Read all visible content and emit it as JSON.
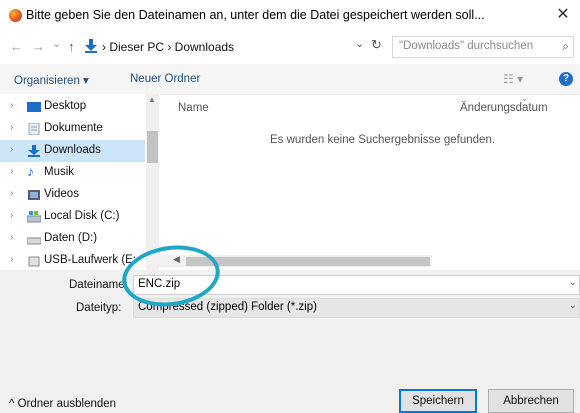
{
  "window": {
    "title": "Bitte geben Sie den Dateinamen an, unter dem die Datei gespeichert werden soll...",
    "close_glyph": "✕"
  },
  "nav": {
    "back_glyph": "←",
    "forward_glyph": "→",
    "recent_glyph": "⌄",
    "up_glyph": "↑",
    "path": "›  Dieser PC  ›  Downloads",
    "dropdown_glyph": "⌄",
    "refresh_glyph": "↻",
    "search_placeholder": "\"Downloads\" durchsuchen",
    "search_glyph": "⌕"
  },
  "toolbar": {
    "organize": "Organisieren ▾",
    "new_folder": "Neuer Ordner",
    "view_glyph": "☷ ▾",
    "help_glyph": "?"
  },
  "sidebar": {
    "items": [
      {
        "label": "Desktop",
        "icon": "desktop-icon",
        "color": "#1e6ec9"
      },
      {
        "label": "Dokumente",
        "icon": "documents-icon",
        "color": "#8fa4b8"
      },
      {
        "label": "Downloads",
        "icon": "downloads-icon",
        "color": "#1e6ec9"
      },
      {
        "label": "Musik",
        "icon": "music-icon",
        "color": "#1e6ec9"
      },
      {
        "label": "Videos",
        "icon": "videos-icon",
        "color": "#5a5a7a"
      },
      {
        "label": "Local Disk (C:)",
        "icon": "drive-icon",
        "color": "#8ca0b8"
      },
      {
        "label": "Daten (D:)",
        "icon": "drive-icon",
        "color": "#9a9a9a"
      },
      {
        "label": "USB-Laufwerk (E:",
        "icon": "usb-drive-icon",
        "color": "#9a9a9a"
      }
    ],
    "selected_index": 2
  },
  "file_list": {
    "col_name": "Name",
    "col_date": "Änderungsdatum",
    "empty_message": "Es wurden keine Suchergebnisse gefunden."
  },
  "form": {
    "filename_label": "Dateiname:",
    "filename_value": "ENC.zip",
    "filetype_label": "Dateityp:",
    "filetype_value": "Compressed (zipped) Folder (*.zip)"
  },
  "footer": {
    "hide_folders": "^ Ordner ausblenden",
    "save": "Speichern",
    "cancel": "Abbrechen"
  },
  "colors": {
    "accent": "#0078d7",
    "selection": "#cde6f7",
    "highlight_ring": "#1ea7c7"
  }
}
